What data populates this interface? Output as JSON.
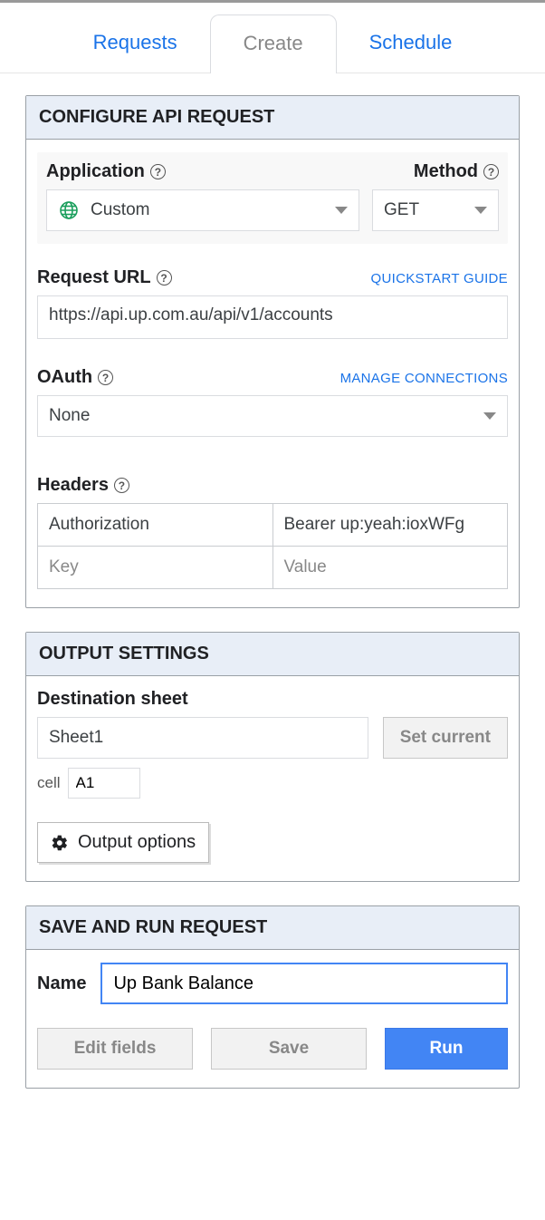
{
  "tabs": {
    "requests": "Requests",
    "create": "Create",
    "schedule": "Schedule"
  },
  "configure": {
    "title": "CONFIGURE API REQUEST",
    "application_label": "Application",
    "application_value": "Custom",
    "method_label": "Method",
    "method_value": "GET",
    "request_url_label": "Request URL",
    "quickstart_link": "QUICKSTART GUIDE",
    "request_url_value": "https://api.up.com.au/api/v1/accounts",
    "oauth_label": "OAuth",
    "manage_connections_link": "MANAGE CONNECTIONS",
    "oauth_value": "None",
    "headers_label": "Headers",
    "headers_rows": [
      {
        "key": "Authorization",
        "value": "Bearer up:yeah:ioxWFg"
      }
    ],
    "headers_key_placeholder": "Key",
    "headers_value_placeholder": "Value"
  },
  "output": {
    "title": "OUTPUT SETTINGS",
    "destination_label": "Destination sheet",
    "destination_value": "Sheet1",
    "set_current_label": "Set current",
    "cell_label": "cell",
    "cell_value": "A1",
    "output_options_label": "Output options"
  },
  "saverun": {
    "title": "SAVE AND RUN REQUEST",
    "name_label": "Name",
    "name_value": "Up Bank Balance",
    "edit_fields_label": "Edit fields",
    "save_label": "Save",
    "run_label": "Run"
  }
}
